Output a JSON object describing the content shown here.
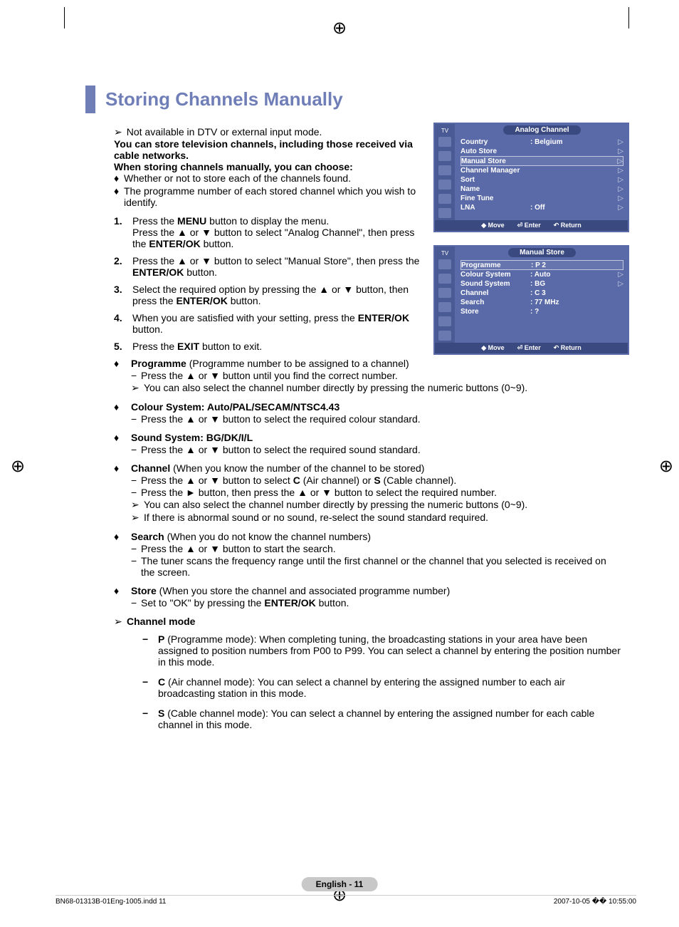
{
  "title": "Storing Channels Manually",
  "intro": {
    "succ": "Not available in DTV or external input mode.",
    "bold1": "You can store television channels, including those received via cable networks.",
    "bold2": "When storing channels manually, you can choose:",
    "bullets": [
      "Whether or not to store each of the channels found.",
      "The programme number of each stored channel which you wish to identify."
    ]
  },
  "steps": [
    {
      "n": "1.",
      "html": "Press the <b>MENU</b> button to display the menu.<br>Press the ▲ or ▼ button to select \"Analog Channel\", then press the <b>ENTER/OK</b> button."
    },
    {
      "n": "2.",
      "html": "Press the ▲ or ▼ button to select \"Manual Store\", then press the <b>ENTER/OK</b> button."
    },
    {
      "n": "3.",
      "html": "Select the required option by pressing the ▲ or ▼ button, then press the <b>ENTER/OK</b> button."
    },
    {
      "n": "4.",
      "html": "When you are satisfied with your setting, press the <b>ENTER/OK</b> button."
    },
    {
      "n": "5.",
      "html": "Press the <b>EXIT</b> button to exit."
    }
  ],
  "options": [
    {
      "head": "<b>Programme</b> (Programme number to be assigned to a channel)",
      "lines": [
        {
          "t": "dash",
          "text": "Press the ▲ or ▼ button until you find the correct number."
        },
        {
          "t": "succ",
          "text": "You can also select the channel number directly by pressing the numeric buttons (0~9)."
        }
      ]
    },
    {
      "head": "<b>Colour System: Auto/PAL/SECAM/NTSC4.43</b>",
      "lines": [
        {
          "t": "dash",
          "text": "Press the ▲ or ▼ button to select the required colour standard."
        }
      ]
    },
    {
      "head": "<b>Sound System: BG/DK/I/L</b>",
      "lines": [
        {
          "t": "dash",
          "text": "Press the ▲ or ▼ button to select the required sound standard."
        }
      ]
    },
    {
      "head": "<b>Channel</b> (When you know the number of the channel to be stored)",
      "lines": [
        {
          "t": "dash",
          "text": "Press the ▲ or ▼ button to select <b>C</b> (Air channel) or <b>S</b> (Cable channel)."
        },
        {
          "t": "dash",
          "text": "Press the ► button, then press the ▲ or ▼ button to select the required number."
        },
        {
          "t": "succ",
          "text": "You can also select the channel number directly by pressing the numeric buttons (0~9)."
        },
        {
          "t": "succ",
          "text": "If there is abnormal sound or no sound, re-select the sound standard required."
        }
      ]
    },
    {
      "head": "<b>Search</b> (When you do not know the channel numbers)",
      "lines": [
        {
          "t": "dash",
          "text": "Press the ▲ or ▼ button to start the search."
        },
        {
          "t": "dash",
          "text": "The tuner scans the frequency range until the first channel or the channel that you selected is received on the screen."
        }
      ]
    },
    {
      "head": "<b>Store</b> (When you store the channel and associated programme number)",
      "lines": [
        {
          "t": "dash",
          "text": "Set to \"OK\" by pressing the <b>ENTER/OK</b> button."
        }
      ]
    }
  ],
  "channel_mode": {
    "head": "Channel mode",
    "items": [
      {
        "k": "P",
        "text": " (Programme mode): When completing tuning, the broadcasting stations in your area have been assigned to position numbers from P00 to P99. You can select a channel by entering the position number in this mode."
      },
      {
        "k": "C",
        "text": " (Air channel mode): You can select a channel by entering the assigned number to each air broadcasting station in this mode."
      },
      {
        "k": "S",
        "text": " (Cable channel mode): You can select a channel by entering the assigned number for each cable channel in this mode."
      }
    ]
  },
  "page_badge": "English - 11",
  "footer": {
    "left": "BN68-01313B-01Eng-1005.indd   11",
    "right": "2007-10-05   �� 10:55:00"
  },
  "osd1": {
    "tv": "TV",
    "title": "Analog Channel",
    "rows": [
      {
        "lbl": "Country",
        "val": ": Belgium",
        "arr": "▷"
      },
      {
        "lbl": "Auto Store",
        "val": "",
        "arr": "▷"
      },
      {
        "lbl": "Manual Store",
        "val": "",
        "arr": "▷",
        "highlight": true
      },
      {
        "lbl": "Channel Manager",
        "val": "",
        "arr": "▷"
      },
      {
        "lbl": "Sort",
        "val": "",
        "arr": "▷"
      },
      {
        "lbl": "Name",
        "val": "",
        "arr": "▷"
      },
      {
        "lbl": "Fine Tune",
        "val": "",
        "arr": "▷"
      },
      {
        "lbl": "LNA",
        "val": ": Off",
        "arr": "▷"
      }
    ],
    "footer": {
      "move": "Move",
      "enter": "Enter",
      "return": "Return"
    }
  },
  "osd2": {
    "tv": "TV",
    "title": "Manual Store",
    "rows": [
      {
        "lbl": "Programme",
        "val": ": P 2",
        "arr": "",
        "highlight": true
      },
      {
        "lbl": "Colour System",
        "val": ": Auto",
        "arr": "▷"
      },
      {
        "lbl": "Sound System",
        "val": ": BG",
        "arr": "▷"
      },
      {
        "lbl": "Channel",
        "val": ": C 3",
        "arr": ""
      },
      {
        "lbl": "Search",
        "val": ": 77 MHz",
        "arr": ""
      },
      {
        "lbl": "Store",
        "val": ": ?",
        "arr": ""
      }
    ],
    "footer": {
      "move": "Move",
      "enter": "Enter",
      "return": "Return"
    }
  }
}
